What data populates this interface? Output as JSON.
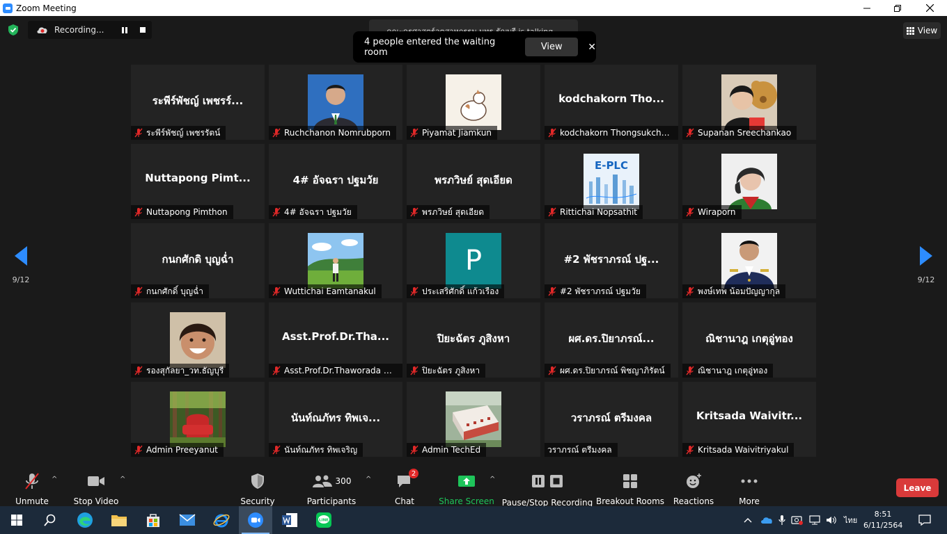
{
  "window": {
    "title": "Zoom Meeting"
  },
  "top_bar": {
    "recording_label": "Recording...",
    "talking_text": "คณะครุศาสตร์อุตสาหกรรม มทร.ธัญบุรี is talking...",
    "notification": {
      "message": "4 people entered the waiting room",
      "view_label": "View",
      "close": "✕"
    },
    "view_label": "View"
  },
  "pager": {
    "left_page": "9/12",
    "right_page": "9/12"
  },
  "participants": [
    {
      "big_name": "ระพีร์พัชญ์ เพชรร์...",
      "name": "ระพีร์พัชญ์ เพชรรัตน์",
      "media": "name"
    },
    {
      "big_name": "",
      "name": "Ruchchanon Nomrubporn",
      "media": "photo",
      "photo": "suit-man"
    },
    {
      "big_name": "",
      "name": "Piyamat Jiamkun",
      "media": "photo",
      "photo": "drawing"
    },
    {
      "big_name": "kodchakorn  Tho...",
      "name": "kodchakorn Thongsukchar...",
      "media": "name"
    },
    {
      "big_name": "",
      "name": "Supanan Sreechankao",
      "media": "photo",
      "photo": "girl-bear"
    },
    {
      "big_name": "Nuttapong  Pimt...",
      "name": "Nuttapong Pimthon",
      "media": "name"
    },
    {
      "big_name": "4# อัจฉรา ปฐมวัย",
      "name": "4# อัจฉรา ปฐมวัย",
      "media": "name"
    },
    {
      "big_name": "พรภวิษย์ สุดเอียด",
      "name": "พรภวิษย์ สุดเอียด",
      "media": "name"
    },
    {
      "big_name": "",
      "name": "Rittichai Nopsathit",
      "media": "photo",
      "photo": "eplc",
      "photo_text": "E-PLC"
    },
    {
      "big_name": "",
      "name": "Wiraporn",
      "media": "photo",
      "photo": "woman-red"
    },
    {
      "big_name": "กนกศักดิ บุญฉ่ำ",
      "name": "กนกศักดิ์ บุญฉ่ำ",
      "media": "name"
    },
    {
      "big_name": "",
      "name": "Wuttichai Eamtanakul",
      "media": "photo",
      "photo": "field"
    },
    {
      "big_name": "",
      "name": "ประเสริศักดิ์ แก้วเรือง",
      "media": "initial",
      "initial": "P"
    },
    {
      "big_name": "#2 พัชราภรณ์ ปฐ...",
      "name": "#2 พัชราภรณ์ ปฐมวัย",
      "media": "name"
    },
    {
      "big_name": "",
      "name": "พงษ์เทพ น้อมปัญญากุล",
      "media": "photo",
      "photo": "uniform"
    },
    {
      "big_name": "",
      "name": "รองสุกัลยา_วท.ธัญบุรี",
      "media": "photo",
      "photo": "smile-woman"
    },
    {
      "big_name": "Asst.Prof.Dr.Tha...",
      "name": "Asst.Prof.Dr.Thaworada  C...",
      "media": "name"
    },
    {
      "big_name": "ปิยะฉัตร ภูสิงหา",
      "name": "ปิยะฉัตร ภูสิงหา",
      "media": "name"
    },
    {
      "big_name": "ผศ.ดร.ปิยาภรณ์...",
      "name": "ผศ.ดร.ปิยาภรณ์ พิชญาภิรัตน์",
      "media": "name"
    },
    {
      "big_name": "ณิชานาฎ เกตุอู่ทอง",
      "name": "ณิชานาฎ เกตุอู่ทอง",
      "media": "name"
    },
    {
      "big_name": "",
      "name": "Admin Preeyanut",
      "media": "photo",
      "photo": "red-chair"
    },
    {
      "big_name": "นันท์ณภัทร ทิพเจ...",
      "name": "นันท์ณภัทร ทิพเจริญ",
      "media": "name"
    },
    {
      "big_name": "",
      "name": "Admin TechEd",
      "media": "photo",
      "photo": "building"
    },
    {
      "big_name": "วราภรณ์ ตรีมงคล",
      "name": "วราภรณ์ ตรีมงคล",
      "media": "name",
      "muted_icon": false
    },
    {
      "big_name": "Kritsada  Waivitr...",
      "name": "Kritsada Waivitriyakul",
      "media": "name"
    }
  ],
  "toolbar": {
    "unmute": "Unmute",
    "stop_video": "Stop Video",
    "security": "Security",
    "participants_count": "300",
    "participants": "Participants",
    "chat": "Chat",
    "chat_badge": "2",
    "share_screen": "Share Screen",
    "pause_stop_recording": "Pause/Stop Recording",
    "breakout_rooms": "Breakout Rooms",
    "reactions": "Reactions",
    "more": "More",
    "leave": "Leave"
  },
  "taskbar": {
    "lang": "ไทย",
    "time": "8:51",
    "date": "6/11/2564"
  },
  "colors": {
    "accent": "#2d8cff",
    "leave": "#d93a3a",
    "share_green": "#1ec45a",
    "mute_red": "#e02828"
  }
}
